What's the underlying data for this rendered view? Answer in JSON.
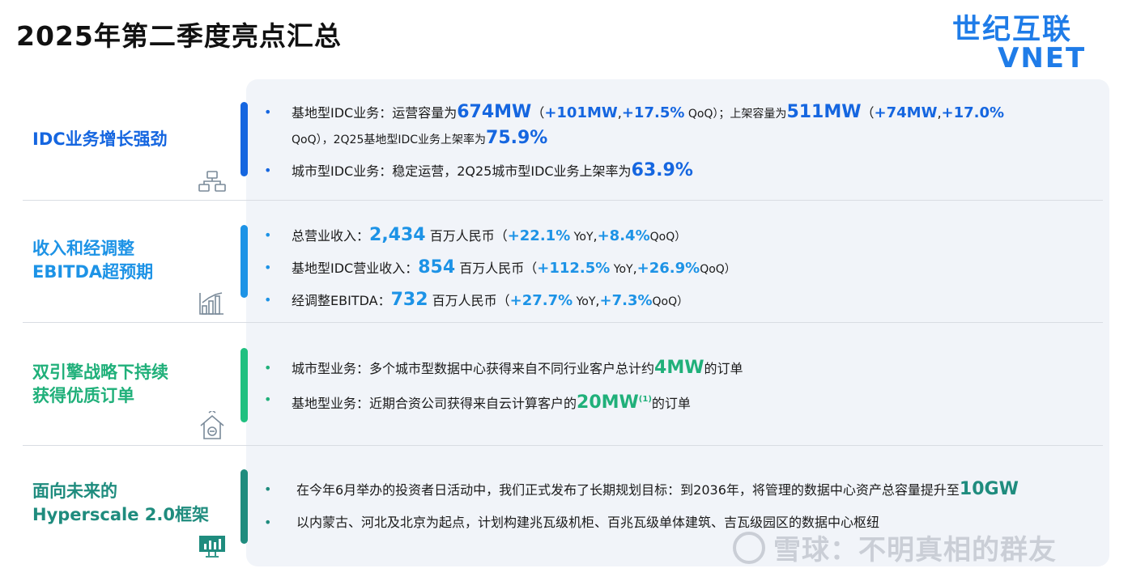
{
  "page": {
    "title": "2025年第二季度亮点汇总"
  },
  "logo": {
    "cn": "世纪互联",
    "en": "VNET"
  },
  "colors": {
    "blue_dark": "#1566e0",
    "blue_mid": "#1d93e6",
    "green": "#20b07a",
    "teal": "#1f8c7e"
  },
  "sections": [
    {
      "title_lines": [
        "IDC业务增长强劲"
      ],
      "icon": "network-icon",
      "bullets": [
        {
          "line1": {
            "t1": "基地型IDC业务：运营容量为",
            "v1": "674MW",
            "t2": "（",
            "v2": "+101MW",
            "t3": ",",
            "v3": "+17.5%",
            "t4": " QoQ）；上架容量为",
            "v4": "511MW",
            "t5": "（",
            "v5": "+74MW",
            "t6": ",",
            "v6": "+17.0%"
          },
          "line2": {
            "t1": "QoQ），2Q25基地型IDC业务上架率为",
            "v1": "75.9%"
          }
        },
        {
          "t1": "城市型IDC业务：稳定运营，2Q25城市型IDC业务上架率为",
          "v1": "63.9%"
        }
      ]
    },
    {
      "title_lines": [
        "收入和经调整",
        "EBITDA超预期"
      ],
      "icon": "bar-chart-icon",
      "bullets": [
        {
          "label": "总营业收入：",
          "value": "2,434",
          "unit": " 百万人民币（",
          "yoy": "+22.1%",
          "yoy_label": " YoY",
          "sep": ",",
          "qoq": "+8.4%",
          "qoq_label": "QoQ）"
        },
        {
          "label": "基地型IDC营业收入：",
          "value": "854",
          "unit": " 百万人民币（",
          "yoy": "+112.5%",
          "yoy_label": " YoY",
          "sep": ",",
          "qoq": "+26.9%",
          "qoq_label": "QoQ）"
        },
        {
          "label": "经调整EBITDA：",
          "value": "732",
          "unit": " 百万人民币（",
          "yoy": "+27.7%",
          "yoy_label": " YoY",
          "sep": ",",
          "qoq": "+7.3%",
          "qoq_label": "QoQ）"
        }
      ]
    },
    {
      "title_lines": [
        "双引擎战略下持续",
        "获得优质订单"
      ],
      "icon": "house-icon",
      "bullets": [
        {
          "t1": "城市型业务：多个城市型数据中心获得来自不同行业客户总计约",
          "v1": "4MW",
          "t2": "的订单"
        },
        {
          "t1": "基地型业务：近期合资公司获得来自云计算客户的",
          "v1": "20MW",
          "note": "(1)",
          "t2": "的订单"
        }
      ]
    },
    {
      "title_lines": [
        "面向未来的",
        "Hyperscale 2.0框架"
      ],
      "icon": "monitor-chart-icon",
      "bullets": [
        {
          "t1": "在今年6月举办的投资者日活动中，我们正式发布了长期规划目标：到2036年，将管理的数据中心资产总容量提升至",
          "v1": "10GW"
        },
        {
          "t1": "以内蒙古、河北及北京为起点，计划构建兆瓦级机柜、百兆瓦级单体建筑、吉瓦级园区的数据中心枢纽"
        }
      ]
    }
  ],
  "watermark": {
    "text": "雪球：不明真相的群友"
  }
}
